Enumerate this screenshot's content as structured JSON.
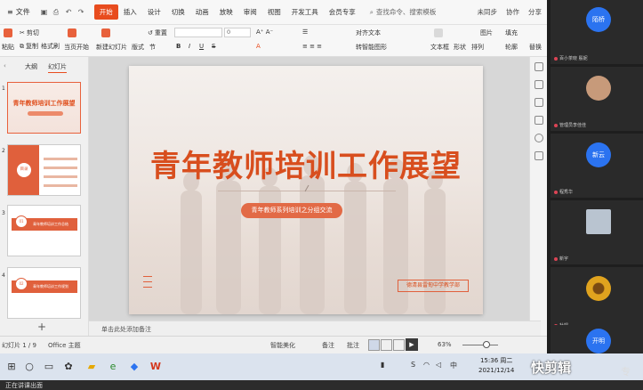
{
  "app": {
    "file_menu": "文件",
    "menu_tabs": [
      "开始",
      "插入",
      "设计",
      "切换",
      "动画",
      "放映",
      "审阅",
      "视图",
      "开发工具",
      "会员专享"
    ],
    "active_tab_index": 0,
    "search_placeholder": "查找命令、搜索模板",
    "right_actions": [
      "未同步",
      "协作",
      "分享"
    ],
    "accent_color": "#e84c1e"
  },
  "ribbon": {
    "paste": "粘贴",
    "cut": "剪切",
    "copy": "复制",
    "format_painter": "格式刷",
    "from_current": "当页开始",
    "new_slide": "新建幻灯片",
    "layout": "版式",
    "section": "节",
    "reset": "重置",
    "font_size": "0",
    "text_align": "对齐文本",
    "convert_smartart": "转智能图形",
    "textbox": "文本框",
    "shape": "形状",
    "arrange": "排列",
    "picture": "图片",
    "fill": "填充",
    "outline": "轮廓",
    "replace": "替换",
    "select": "选择"
  },
  "left_panel": {
    "tabs": [
      "大纲",
      "幻灯片"
    ],
    "active_tab_index": 1,
    "slides": [
      {
        "num": "1",
        "title": "青年教师培训工作展望"
      },
      {
        "num": "2",
        "label": "目录"
      },
      {
        "num": "3",
        "label": "01",
        "text": "青年教师培训工作总结"
      },
      {
        "num": "4",
        "label": "02",
        "text": "青年教师培训工作规划"
      }
    ],
    "add_label": "+"
  },
  "slide": {
    "title": "青年教师培训工作展望",
    "subtitle": "青年教师系列培训之分组交流",
    "org": "德清县雷甸中学教学部",
    "title_color": "#d84e1e"
  },
  "notes_placeholder": "单击此处添加备注",
  "statusbar": {
    "slide_pos": "幻灯片 1 / 9",
    "theme": "Office 主题",
    "smart_beautify": "智能美化",
    "notes": "备注",
    "comment": "批注",
    "zoom": "63%"
  },
  "taskbar": {
    "time": "15:36 周二",
    "date": "2021/12/14",
    "ime": "中",
    "tray_s": "S"
  },
  "bottom_strip": "正在讲课出面",
  "watermark": "快剪辑",
  "watermark_sm": "专",
  "video_tiles": [
    {
      "avatar_text": "陌桥",
      "name": "",
      "type": "blue"
    },
    {
      "avatar_text": "",
      "name": "管理员李佳佳",
      "type": "photo",
      "color": "#c79a7a"
    },
    {
      "avatar_text": "新云",
      "name": "程秀华",
      "type": "blue"
    },
    {
      "avatar_text": "",
      "name": "新宇",
      "type": "photo",
      "color": "#b9c4d0"
    },
    {
      "avatar_text": "",
      "name": "杜娟",
      "type": "photo",
      "color": "#e0a31e"
    },
    {
      "avatar_text": "开明",
      "name": "",
      "type": "blue"
    }
  ],
  "tile_top_label": "百小茶晓 殷妮"
}
